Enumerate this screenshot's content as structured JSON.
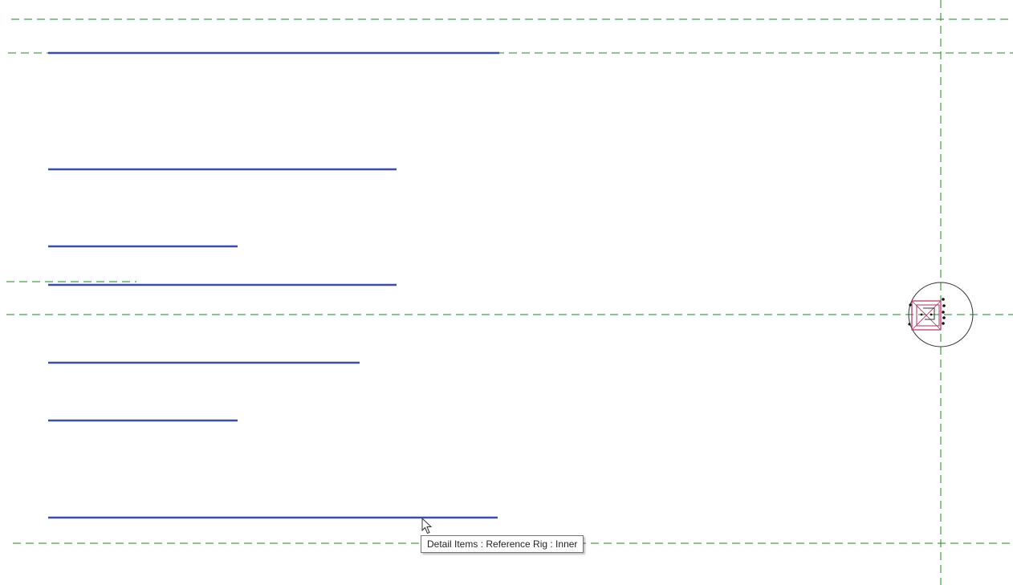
{
  "view": {
    "name": "drafting-view-canvas",
    "background_color": "#ffffff",
    "reference_plane_color": "#1e8a1e",
    "detail_line_color": "#3a4fa8",
    "component_color": "#b03060"
  },
  "tooltip": {
    "text": "Detail Items : Reference Rig : Inner"
  },
  "cursor": {
    "icon": "arrow-pointer-icon"
  },
  "component": {
    "icon": "reference-rig-symbol-icon"
  }
}
